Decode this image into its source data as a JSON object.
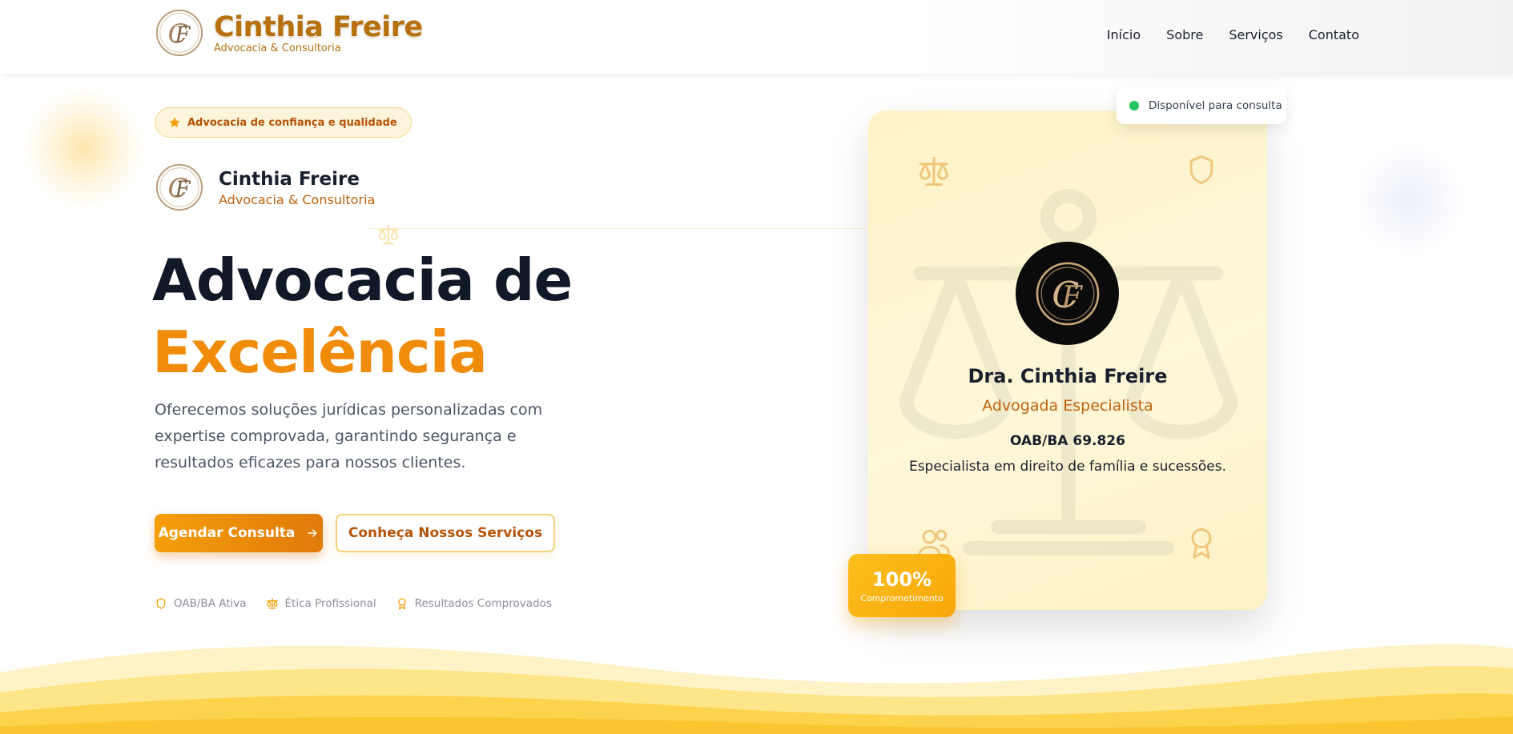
{
  "header": {
    "brand_name": "Cinthia Freire",
    "brand_tagline": "Advocacia & Consultoria",
    "nav": [
      {
        "label": "Início"
      },
      {
        "label": "Sobre"
      },
      {
        "label": "Serviços"
      },
      {
        "label": "Contato"
      }
    ]
  },
  "hero": {
    "badge": "Advocacia de confiança e qualidade",
    "profile_name": "Cinthia Freire",
    "profile_tagline": "Advocacia & Consultoria",
    "title_line1": "Advocacia de",
    "title_line2": "Excelência",
    "lead": "Oferecemos soluções jurídicas personalizadas com expertise comprovada, garantindo segurança e resultados eficazes para nossos clientes.",
    "primary_button": "Agendar Consulta",
    "secondary_button": "Conheça Nossos Serviços",
    "trust": [
      {
        "label": "OAB/BA Ativa",
        "icon": "shield-icon"
      },
      {
        "label": "Ética Profissional",
        "icon": "scale-icon"
      },
      {
        "label": "Resultados Comprovados",
        "icon": "award-icon"
      }
    ]
  },
  "card": {
    "status": "Disponível para consulta",
    "name": "Dra. Cinthia Freire",
    "role": "Advogada Especialista",
    "oab": "OAB/BA 69.826",
    "specialty": "Especialista em direito de família e sucessões.",
    "stat_value": "100%",
    "stat_label": "Comprometimento"
  },
  "colors": {
    "accent": "#f59e0b",
    "accent_dark": "#b45309",
    "status_green": "#22c55e",
    "text_dark": "#111827"
  }
}
